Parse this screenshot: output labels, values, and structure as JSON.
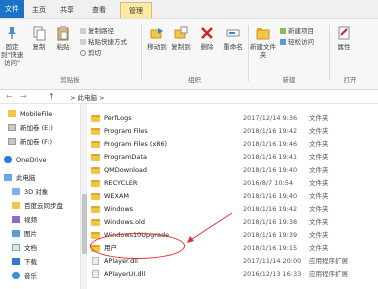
{
  "tabs": [
    {
      "label": "文件"
    },
    {
      "label": "主页"
    },
    {
      "label": "共享"
    },
    {
      "label": "查看"
    },
    {
      "label": "管理"
    }
  ],
  "ribbon": {
    "pin_label": "固定到\"快速访问\"",
    "copy_label": "复制",
    "paste_label": "粘贴",
    "copy_path_label": "复制路径",
    "paste_shortcut_label": "粘贴快捷方式",
    "cut_label": "剪切",
    "clipboard_group": "剪贴板",
    "move_to_label": "移动到",
    "copy_to_label": "复制到",
    "delete_label": "删除",
    "rename_label": "重命名",
    "organize_group": "组织",
    "new_folder_label": "新建文件夹",
    "new_item_label": "新建项目",
    "easy_access_label": "轻松访问",
    "new_group": "新建",
    "properties_label": "属性",
    "open_group": "打开"
  },
  "address": {
    "back": "←",
    "forward": "→",
    "up": "↑",
    "path": "> 此电脑 >"
  },
  "nav": {
    "items": [
      {
        "label": "MobileFile"
      },
      {
        "label": "新加卷 (E:)"
      },
      {
        "label": "新加卷 (F:)"
      },
      {
        "label": "OneDrive"
      },
      {
        "label": "此电脑"
      },
      {
        "label": "3D 对象"
      },
      {
        "label": "百度云同步盘"
      },
      {
        "label": "视频"
      },
      {
        "label": "图片"
      },
      {
        "label": "文档"
      },
      {
        "label": "下载"
      },
      {
        "label": "音乐"
      }
    ]
  },
  "files": [
    {
      "name": "PerfLogs",
      "date": "2017/12/14 9:36",
      "type": "文件夹",
      "kind": "folder"
    },
    {
      "name": "Program Files",
      "date": "2018/1/16 19:42",
      "type": "文件夹",
      "kind": "folder"
    },
    {
      "name": "Program Files (x86)",
      "date": "2018/1/16 19:46",
      "type": "文件夹",
      "kind": "folder"
    },
    {
      "name": "ProgramData",
      "date": "2018/1/16 19:41",
      "type": "文件夹",
      "kind": "folder"
    },
    {
      "name": "QMDownload",
      "date": "2018/1/16 19:40",
      "type": "文件夹",
      "kind": "folder"
    },
    {
      "name": "RECYCLER",
      "date": "2016/8/7 10:54",
      "type": "文件夹",
      "kind": "folder"
    },
    {
      "name": "WEXAM",
      "date": "2018/1/16 19:40",
      "type": "文件夹",
      "kind": "folder"
    },
    {
      "name": "Windows",
      "date": "2018/1/16 19:42",
      "type": "文件夹",
      "kind": "folder"
    },
    {
      "name": "Windows.old",
      "date": "2018/1/16 19:38",
      "type": "文件夹",
      "kind": "folder"
    },
    {
      "name": "Windows10Upgrade",
      "date": "2018/1/16 19:39",
      "type": "文件夹",
      "kind": "folder"
    },
    {
      "name": "用户",
      "date": "2018/1/16 19:15",
      "type": "文件夹",
      "kind": "folder"
    },
    {
      "name": "APlayer.dll",
      "date": "2017/11/14 20:00",
      "type": "应用程序扩展",
      "kind": "dll"
    },
    {
      "name": "APlayerUI.dll",
      "date": "2016/12/13 16:33",
      "type": "应用程序扩展",
      "kind": "dll"
    }
  ],
  "colors": {
    "accent": "#1a73c8",
    "folder": "#f1c545",
    "annotation": "#e22b2b",
    "manage_tab": "#ffe8a0"
  }
}
